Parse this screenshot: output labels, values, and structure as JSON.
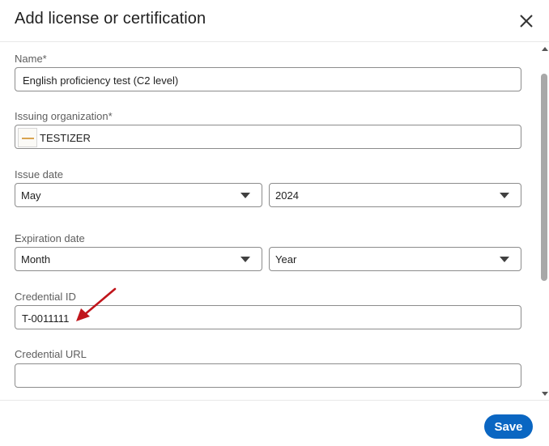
{
  "dialog": {
    "title": "Add license or certification",
    "close_icon": "close-icon"
  },
  "form": {
    "name": {
      "label": "Name*",
      "value": "English proficiency test (C2 level)"
    },
    "issuing_org": {
      "label": "Issuing organization*",
      "value": "TESTIZER",
      "logo_icon": "organization-logo"
    },
    "issue_date": {
      "label": "Issue date",
      "month": "May",
      "year": "2024"
    },
    "expiration_date": {
      "label": "Expiration date",
      "month": "Month",
      "year": "Year"
    },
    "credential_id": {
      "label": "Credential ID",
      "value": "T-0011111"
    },
    "credential_url": {
      "label": "Credential URL",
      "value": ""
    }
  },
  "annotation": {
    "arrow_color": "#c0151b"
  },
  "footer": {
    "save_label": "Save"
  },
  "colors": {
    "accent": "#0a66c2",
    "border": "#8c8c8c",
    "label": "#5e5e5e"
  }
}
